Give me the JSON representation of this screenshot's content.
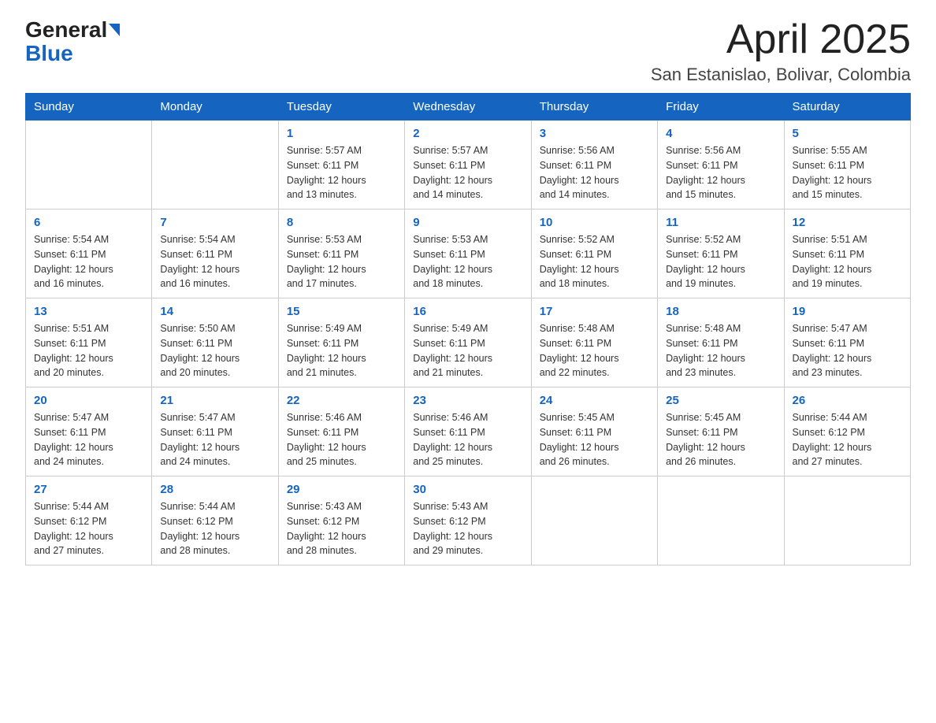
{
  "header": {
    "logo_part1": "General",
    "logo_part2": "Blue",
    "title": "April 2025",
    "subtitle": "San Estanislao, Bolivar, Colombia"
  },
  "days_of_week": [
    "Sunday",
    "Monday",
    "Tuesday",
    "Wednesday",
    "Thursday",
    "Friday",
    "Saturday"
  ],
  "weeks": [
    [
      {
        "day": "",
        "info": ""
      },
      {
        "day": "",
        "info": ""
      },
      {
        "day": "1",
        "info": "Sunrise: 5:57 AM\nSunset: 6:11 PM\nDaylight: 12 hours\nand 13 minutes."
      },
      {
        "day": "2",
        "info": "Sunrise: 5:57 AM\nSunset: 6:11 PM\nDaylight: 12 hours\nand 14 minutes."
      },
      {
        "day": "3",
        "info": "Sunrise: 5:56 AM\nSunset: 6:11 PM\nDaylight: 12 hours\nand 14 minutes."
      },
      {
        "day": "4",
        "info": "Sunrise: 5:56 AM\nSunset: 6:11 PM\nDaylight: 12 hours\nand 15 minutes."
      },
      {
        "day": "5",
        "info": "Sunrise: 5:55 AM\nSunset: 6:11 PM\nDaylight: 12 hours\nand 15 minutes."
      }
    ],
    [
      {
        "day": "6",
        "info": "Sunrise: 5:54 AM\nSunset: 6:11 PM\nDaylight: 12 hours\nand 16 minutes."
      },
      {
        "day": "7",
        "info": "Sunrise: 5:54 AM\nSunset: 6:11 PM\nDaylight: 12 hours\nand 16 minutes."
      },
      {
        "day": "8",
        "info": "Sunrise: 5:53 AM\nSunset: 6:11 PM\nDaylight: 12 hours\nand 17 minutes."
      },
      {
        "day": "9",
        "info": "Sunrise: 5:53 AM\nSunset: 6:11 PM\nDaylight: 12 hours\nand 18 minutes."
      },
      {
        "day": "10",
        "info": "Sunrise: 5:52 AM\nSunset: 6:11 PM\nDaylight: 12 hours\nand 18 minutes."
      },
      {
        "day": "11",
        "info": "Sunrise: 5:52 AM\nSunset: 6:11 PM\nDaylight: 12 hours\nand 19 minutes."
      },
      {
        "day": "12",
        "info": "Sunrise: 5:51 AM\nSunset: 6:11 PM\nDaylight: 12 hours\nand 19 minutes."
      }
    ],
    [
      {
        "day": "13",
        "info": "Sunrise: 5:51 AM\nSunset: 6:11 PM\nDaylight: 12 hours\nand 20 minutes."
      },
      {
        "day": "14",
        "info": "Sunrise: 5:50 AM\nSunset: 6:11 PM\nDaylight: 12 hours\nand 20 minutes."
      },
      {
        "day": "15",
        "info": "Sunrise: 5:49 AM\nSunset: 6:11 PM\nDaylight: 12 hours\nand 21 minutes."
      },
      {
        "day": "16",
        "info": "Sunrise: 5:49 AM\nSunset: 6:11 PM\nDaylight: 12 hours\nand 21 minutes."
      },
      {
        "day": "17",
        "info": "Sunrise: 5:48 AM\nSunset: 6:11 PM\nDaylight: 12 hours\nand 22 minutes."
      },
      {
        "day": "18",
        "info": "Sunrise: 5:48 AM\nSunset: 6:11 PM\nDaylight: 12 hours\nand 23 minutes."
      },
      {
        "day": "19",
        "info": "Sunrise: 5:47 AM\nSunset: 6:11 PM\nDaylight: 12 hours\nand 23 minutes."
      }
    ],
    [
      {
        "day": "20",
        "info": "Sunrise: 5:47 AM\nSunset: 6:11 PM\nDaylight: 12 hours\nand 24 minutes."
      },
      {
        "day": "21",
        "info": "Sunrise: 5:47 AM\nSunset: 6:11 PM\nDaylight: 12 hours\nand 24 minutes."
      },
      {
        "day": "22",
        "info": "Sunrise: 5:46 AM\nSunset: 6:11 PM\nDaylight: 12 hours\nand 25 minutes."
      },
      {
        "day": "23",
        "info": "Sunrise: 5:46 AM\nSunset: 6:11 PM\nDaylight: 12 hours\nand 25 minutes."
      },
      {
        "day": "24",
        "info": "Sunrise: 5:45 AM\nSunset: 6:11 PM\nDaylight: 12 hours\nand 26 minutes."
      },
      {
        "day": "25",
        "info": "Sunrise: 5:45 AM\nSunset: 6:11 PM\nDaylight: 12 hours\nand 26 minutes."
      },
      {
        "day": "26",
        "info": "Sunrise: 5:44 AM\nSunset: 6:12 PM\nDaylight: 12 hours\nand 27 minutes."
      }
    ],
    [
      {
        "day": "27",
        "info": "Sunrise: 5:44 AM\nSunset: 6:12 PM\nDaylight: 12 hours\nand 27 minutes."
      },
      {
        "day": "28",
        "info": "Sunrise: 5:44 AM\nSunset: 6:12 PM\nDaylight: 12 hours\nand 28 minutes."
      },
      {
        "day": "29",
        "info": "Sunrise: 5:43 AM\nSunset: 6:12 PM\nDaylight: 12 hours\nand 28 minutes."
      },
      {
        "day": "30",
        "info": "Sunrise: 5:43 AM\nSunset: 6:12 PM\nDaylight: 12 hours\nand 29 minutes."
      },
      {
        "day": "",
        "info": ""
      },
      {
        "day": "",
        "info": ""
      },
      {
        "day": "",
        "info": ""
      }
    ]
  ]
}
